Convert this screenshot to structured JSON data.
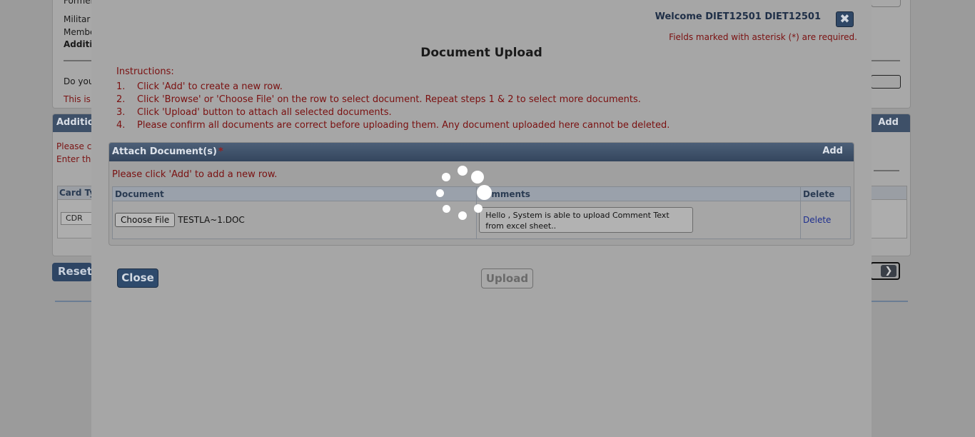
{
  "background": {
    "form_lines": [
      "Former",
      "Militar",
      "Membe",
      "Additi"
    ],
    "question_prefix": "Do you",
    "notice_prefix": "This is",
    "section_title": "Additio",
    "section_add": "Add",
    "hint_1": "Please c",
    "hint_2": "Enter th",
    "table_header": "Card Ty",
    "card_type_value": "CDR",
    "reset_label": "Reset",
    "next_icon": "chevron-right-icon"
  },
  "modal": {
    "welcome": "Welcome DIET12501 DIET12501",
    "close_icon": "close-icon",
    "required_note": "Fields marked with asterisk (*) are required.",
    "title": "Document Upload",
    "instructions_label": "Instructions:",
    "instructions": [
      {
        "num": "1.",
        "text": "Click 'Add' to create a new row."
      },
      {
        "num": "2.",
        "text": "Click 'Browse' or 'Choose File' on the row to select document. Repeat steps 1 & 2 to select more documents."
      },
      {
        "num": "3.",
        "text": "Click 'Upload' button to attach all selected documents."
      },
      {
        "num": "4.",
        "text": "Please confirm all documents are correct before uploading them. Any document uploaded here cannot be deleted."
      }
    ],
    "attach": {
      "title": "Attach Document(s)",
      "required_mark": "*",
      "add_label": "Add",
      "hint": "Please click 'Add' to add a new row.",
      "columns": [
        "Document",
        "Comments",
        "Delete"
      ],
      "rows": [
        {
          "choose_file_label": "Choose File",
          "file_name": "TESTLA~1.DOC",
          "comment": "Hello , System is able to upload Comment Text from excel sheet..",
          "delete_label": "Delete"
        }
      ]
    },
    "close_label": "Close",
    "upload_label": "Upload"
  },
  "colors": {
    "header_bar": "#34465e",
    "instruction_red": "#7a1010",
    "button_blue": "#2e4a6c"
  }
}
